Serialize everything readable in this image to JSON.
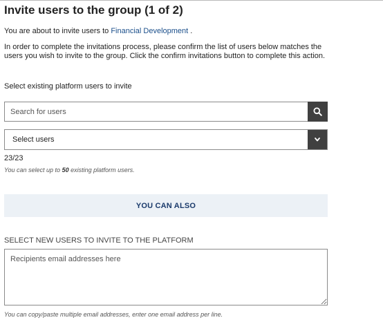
{
  "title": "Invite users to the group (1 of 2)",
  "intro": {
    "prefix": "You are about to invite users to ",
    "group_link": "Financial Development",
    "suffix": " ."
  },
  "explanation": "In order to complete the invitations process, please confirm the list of users below matches the users you wish to invite to the group. Click the confirm invitations button to complete this action.",
  "existing": {
    "label": "Select existing platform users to invite",
    "search_placeholder": "Search for users",
    "search_icon": "search-icon",
    "select_value": "Select users",
    "select_icon": "chevron-down-icon",
    "count": "23/23",
    "hint_prefix": "You can select up to ",
    "hint_limit": "50",
    "hint_suffix": " existing platform users."
  },
  "also_banner": "YOU CAN ALSO",
  "new_users": {
    "label": "SELECT NEW USERS TO INVITE TO THE PLATFORM",
    "email_placeholder": "Recipients email addresses here",
    "hint": "You can copy/paste multiple email addresses, enter one email address per line."
  },
  "colors": {
    "link": "#1a4e8a",
    "button_dark": "#404040",
    "banner_bg": "#ecf1f6",
    "banner_text": "#1a3a6b"
  }
}
